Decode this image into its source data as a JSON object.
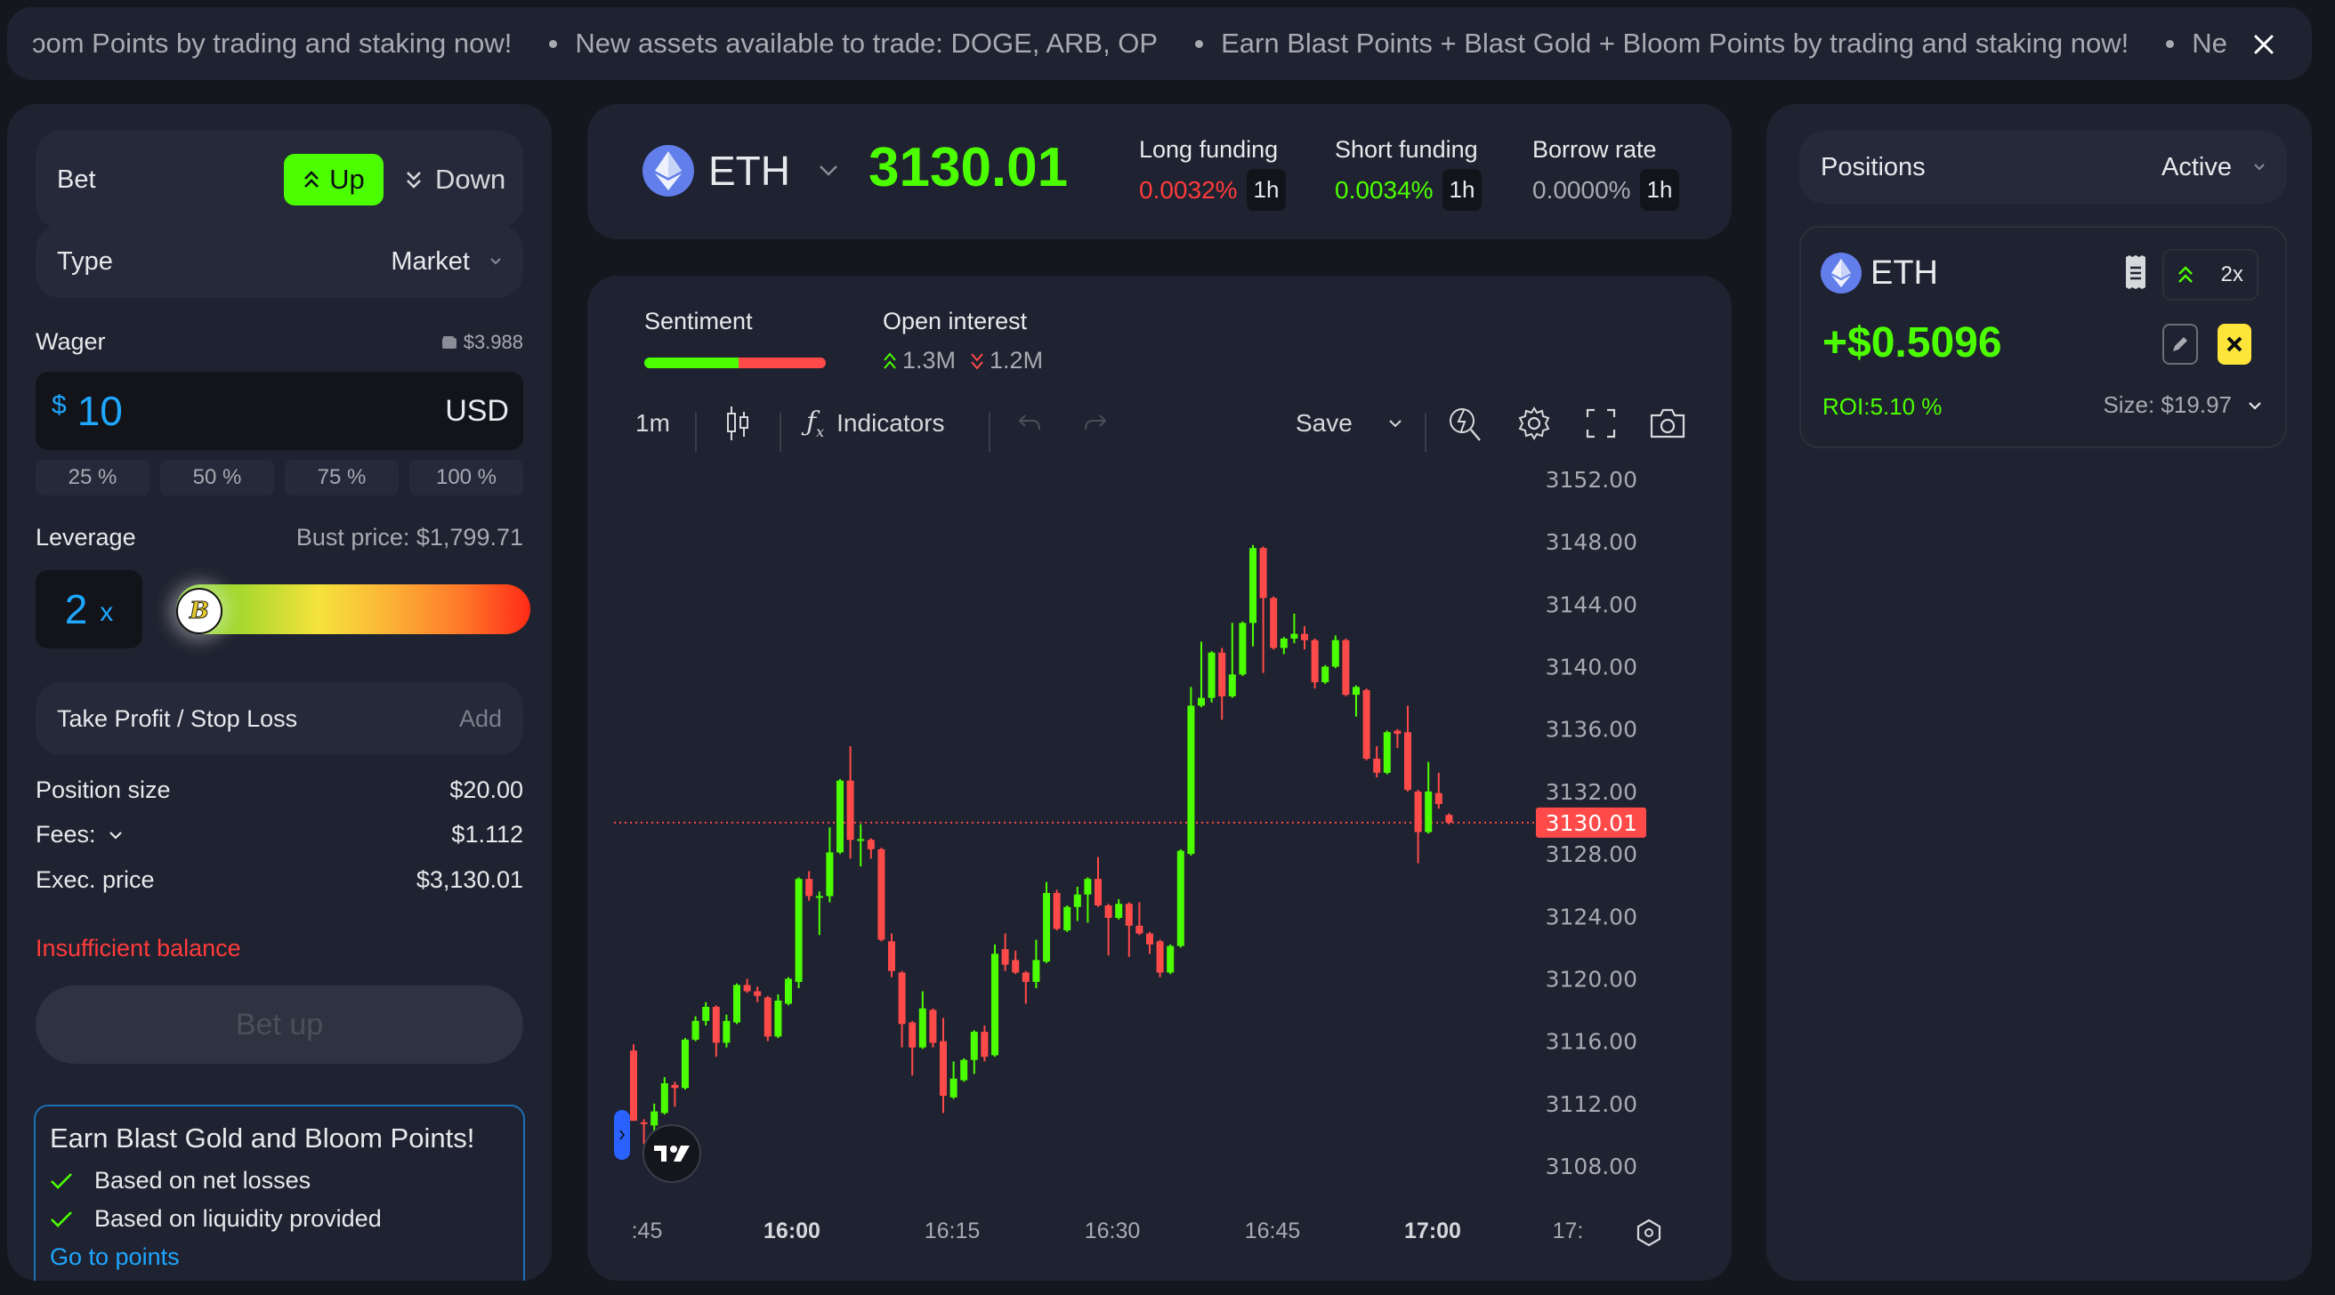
{
  "ticker": {
    "items": [
      "ɔom Points by trading and staking now!",
      "New assets available to trade: DOGE, ARB, OP",
      "Earn Blast Points + Blast Gold + Bloom Points by trading and staking now!",
      "Ne"
    ],
    "close_icon": "close-icon"
  },
  "order": {
    "bet_label": "Bet",
    "up_label": "Up",
    "down_label": "Down",
    "selected_direction": "Up",
    "type_label": "Type",
    "type_value": "Market",
    "wager_label": "Wager",
    "wallet_balance": "$3.988",
    "wager_currency_symbol": "$",
    "wager_value": "10",
    "wager_unit": "USD",
    "pct_options": [
      "25 %",
      "50 %",
      "75 %",
      "100 %"
    ],
    "leverage_label": "Leverage",
    "bust_price": "Bust price: $1,799.71",
    "leverage_value": "2",
    "leverage_suffix": "x",
    "leverage_slider_fraction": 0.0,
    "leverage_thumb_glyph": "B",
    "tpsl_label": "Take Profit / Stop Loss",
    "tpsl_action": "Add",
    "position_size_label": "Position size",
    "position_size_value": "$20.00",
    "fees_label": "Fees:",
    "fees_value": "$1.112",
    "exec_price_label": "Exec. price",
    "exec_price_value": "$3,130.01",
    "error_text": "Insufficient balance",
    "submit_label": "Bet up"
  },
  "promo": {
    "title": "Earn Blast Gold and Bloom Points!",
    "items": [
      "Based on net losses",
      "Based on liquidity provided"
    ],
    "link": "Go to points"
  },
  "market": {
    "asset": "ETH",
    "price": "3130.01",
    "long_funding_label": "Long funding",
    "long_funding_value": "0.0032%",
    "short_funding_label": "Short funding",
    "short_funding_value": "0.0034%",
    "borrow_rate_label": "Borrow rate",
    "borrow_rate_value": "0.0000%",
    "interval": "1h"
  },
  "stats": {
    "sentiment_label": "Sentiment",
    "sentiment_long_fraction": 0.52,
    "open_interest_label": "Open interest",
    "oi_long": "1.3M",
    "oi_short": "1.2M"
  },
  "toolbar": {
    "timeframe": "1m",
    "indicators_label": "Indicators",
    "save_label": "Save"
  },
  "colors": {
    "up": "#4cff00",
    "down": "#ff4a4a",
    "accent_blue": "#1ea7ff",
    "panel": "#1f2230",
    "bg": "#15171e",
    "close_yellow": "#fde53a"
  },
  "positions": {
    "title": "Positions",
    "filter": "Active",
    "cards": [
      {
        "asset": "ETH",
        "direction": "up",
        "leverage": "2x",
        "pnl": "+$0.5096",
        "roi": "ROI:5.10 %",
        "size": "Size: $19.97"
      }
    ]
  },
  "chart_data": {
    "type": "candlestick",
    "title": "ETH 1m",
    "xlabel": "",
    "ylabel": "",
    "ylim": [
      3108,
      3152
    ],
    "y_ticks": [
      "3152.00",
      "3148.00",
      "3144.00",
      "3140.00",
      "3136.00",
      "3132.00",
      "3128.00",
      "3124.00",
      "3120.00",
      "3116.00",
      "3112.00",
      "3108.00"
    ],
    "x_ticks": [
      ":45",
      "16:00",
      "16:15",
      "16:30",
      "16:45",
      "17:00",
      "17:"
    ],
    "x_ticks_bold": [
      "16:00",
      "17:00"
    ],
    "last_price": "3130.01",
    "last_price_value": 3130.01,
    "grid": false,
    "candles": [
      [
        3115.4,
        3115.8,
        3110.9,
        3110.9
      ],
      [
        3110.8,
        3111.0,
        3109.4,
        3110.7
      ],
      [
        3110.6,
        3112.0,
        3110.1,
        3111.5
      ],
      [
        3111.4,
        3113.7,
        3111.3,
        3113.3
      ],
      [
        3113.2,
        3113.4,
        3111.8,
        3113.0
      ],
      [
        3113.0,
        3116.2,
        3112.9,
        3116.1
      ],
      [
        3116.1,
        3117.6,
        3116.0,
        3117.3
      ],
      [
        3117.3,
        3118.5,
        3117.0,
        3118.2
      ],
      [
        3118.2,
        3118.3,
        3115.0,
        3115.9
      ],
      [
        3115.9,
        3117.7,
        3115.6,
        3117.3
      ],
      [
        3117.2,
        3119.7,
        3117.1,
        3119.6
      ],
      [
        3119.6,
        3120.0,
        3119.1,
        3119.2
      ],
      [
        3119.2,
        3119.5,
        3118.5,
        3118.9
      ],
      [
        3118.8,
        3118.9,
        3116.0,
        3116.3
      ],
      [
        3116.3,
        3119.0,
        3116.2,
        3118.6
      ],
      [
        3118.4,
        3120.1,
        3118.3,
        3120.0
      ],
      [
        3119.8,
        3126.5,
        3119.4,
        3126.4
      ],
      [
        3126.4,
        3126.9,
        3125.0,
        3125.3
      ],
      [
        3125.3,
        3125.6,
        3122.8,
        3125.3
      ],
      [
        3125.3,
        3129.7,
        3124.9,
        3128.1
      ],
      [
        3128.1,
        3132.8,
        3128.0,
        3132.7
      ],
      [
        3132.7,
        3134.9,
        3127.7,
        3128.9
      ],
      [
        3128.9,
        3129.9,
        3127.2,
        3128.95
      ],
      [
        3128.9,
        3129.0,
        3127.7,
        3128.3
      ],
      [
        3128.3,
        3128.4,
        3122.4,
        3122.5
      ],
      [
        3122.4,
        3122.9,
        3120.1,
        3120.5
      ],
      [
        3120.4,
        3120.5,
        3115.6,
        3117.1
      ],
      [
        3117.2,
        3117.3,
        3113.8,
        3115.6
      ],
      [
        3115.6,
        3119.2,
        3115.5,
        3118.1
      ],
      [
        3118.0,
        3118.1,
        3115.6,
        3115.9
      ],
      [
        3116.0,
        3117.5,
        3111.4,
        3112.5
      ],
      [
        3112.4,
        3114.7,
        3112.3,
        3113.6
      ],
      [
        3113.5,
        3114.9,
        3113.4,
        3114.8
      ],
      [
        3114.8,
        3116.7,
        3113.9,
        3116.6
      ],
      [
        3116.6,
        3117.0,
        3114.7,
        3115.0
      ],
      [
        3115.1,
        3122.2,
        3115.0,
        3121.6
      ],
      [
        3121.9,
        3122.9,
        3120.5,
        3120.9
      ],
      [
        3121.2,
        3121.8,
        3120.3,
        3120.4
      ],
      [
        3120.4,
        3120.5,
        3118.4,
        3119.8
      ],
      [
        3119.8,
        3122.5,
        3119.4,
        3121.2
      ],
      [
        3121.1,
        3126.2,
        3121.0,
        3125.5
      ],
      [
        3125.5,
        3125.7,
        3123.1,
        3123.2
      ],
      [
        3123.1,
        3124.7,
        3123.0,
        3124.6
      ],
      [
        3124.6,
        3125.9,
        3123.7,
        3125.4
      ],
      [
        3125.4,
        3126.5,
        3123.6,
        3126.4
      ],
      [
        3126.4,
        3127.8,
        3124.6,
        3124.7
      ],
      [
        3124.7,
        3124.8,
        3121.5,
        3123.9
      ],
      [
        3123.9,
        3125.1,
        3123.8,
        3124.8
      ],
      [
        3124.8,
        3124.9,
        3121.4,
        3123.4
      ],
      [
        3123.4,
        3124.9,
        3122.8,
        3122.9
      ],
      [
        3122.9,
        3123.0,
        3121.6,
        3122.2
      ],
      [
        3122.4,
        3122.5,
        3120.1,
        3120.4
      ],
      [
        3120.4,
        3122.2,
        3120.3,
        3122.1
      ],
      [
        3122.1,
        3128.3,
        3122.0,
        3128.2
      ],
      [
        3128.0,
        3138.7,
        3127.9,
        3137.5
      ],
      [
        3137.5,
        3141.6,
        3137.4,
        3138.0
      ],
      [
        3138.0,
        3141.0,
        3137.7,
        3140.9
      ],
      [
        3140.9,
        3141.2,
        3136.6,
        3138.1
      ],
      [
        3138.1,
        3142.8,
        3138.0,
        3139.5
      ],
      [
        3139.5,
        3142.9,
        3139.4,
        3142.8
      ],
      [
        3142.8,
        3147.8,
        3141.3,
        3147.6
      ],
      [
        3147.6,
        3147.7,
        3139.6,
        3144.4
      ],
      [
        3144.4,
        3144.5,
        3141.1,
        3141.2
      ],
      [
        3141.2,
        3141.9,
        3140.8,
        3141.8
      ],
      [
        3141.8,
        3143.4,
        3141.5,
        3142.1
      ],
      [
        3142.1,
        3142.6,
        3141.1,
        3141.7
      ],
      [
        3141.7,
        3141.8,
        3138.6,
        3139.0
      ],
      [
        3139.0,
        3140.1,
        3138.9,
        3140.0
      ],
      [
        3140.0,
        3142.0,
        3139.9,
        3141.7
      ],
      [
        3141.7,
        3141.8,
        3138.1,
        3138.2
      ],
      [
        3138.2,
        3138.8,
        3136.8,
        3138.7
      ],
      [
        3138.5,
        3138.6,
        3134.0,
        3134.1
      ],
      [
        3134.1,
        3134.9,
        3132.9,
        3133.2
      ],
      [
        3133.2,
        3135.9,
        3133.1,
        3135.8
      ],
      [
        3135.9,
        3136.0,
        3134.8,
        3135.7
      ],
      [
        3135.8,
        3137.5,
        3132.0,
        3132.1
      ],
      [
        3132.0,
        3132.1,
        3127.4,
        3129.4
      ],
      [
        3129.4,
        3133.9,
        3129.3,
        3132.0
      ],
      [
        3131.9,
        3133.2,
        3130.9,
        3131.2
      ],
      [
        3130.5,
        3130.6,
        3129.9,
        3130.01
      ]
    ],
    "candle_fields": [
      "open",
      "high",
      "low",
      "close"
    ]
  }
}
